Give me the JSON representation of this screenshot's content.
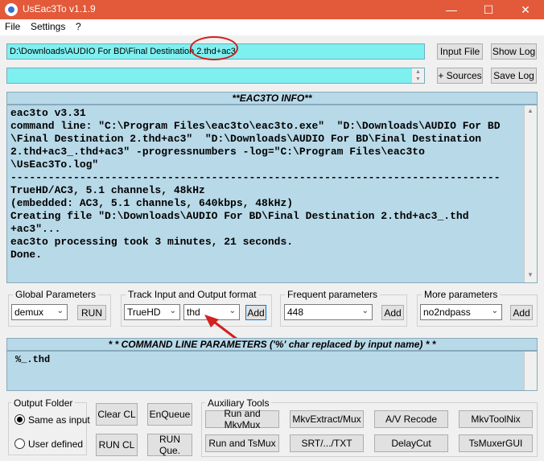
{
  "window": {
    "title": "UsEac3To v1.1.9",
    "minimize_glyph": "—",
    "maximize_glyph": "☐",
    "close_glyph": "✕"
  },
  "menu": {
    "file": "File",
    "settings": "Settings",
    "help": "?"
  },
  "input_path": "D:\\Downloads\\AUDIO For BD\\Final Destination 2.thd+ac3",
  "buttons": {
    "input_file": "Input File",
    "show_log": "Show Log",
    "add_sources": "+ Sources",
    "save_log": "Save Log",
    "run": "RUN",
    "add": "Add",
    "clear_cl": "Clear CL",
    "enqueue": "EnQueue",
    "run_cl": "RUN CL",
    "run_queue": "RUN Que."
  },
  "info_header": "**EAC3TO INFO**",
  "log_lines": [
    "eac3to v3.31",
    "command line: \"C:\\Program Files\\eac3to\\eac3to.exe\"  \"D:\\Downloads\\AUDIO For BD",
    "\\Final Destination 2.thd+ac3\"  \"D:\\Downloads\\AUDIO For BD\\Final Destination",
    "2.thd+ac3_.thd+ac3\" -progressnumbers -log=\"C:\\Program Files\\eac3to",
    "\\UsEac3To.log\"",
    "------------------------------------------------------------------------------",
    "TrueHD/AC3, 5.1 channels, 48kHz",
    "(embedded: AC3, 5.1 channels, 640kbps, 48kHz)",
    "Creating file \"D:\\Downloads\\AUDIO For BD\\Final Destination 2.thd+ac3_.thd",
    "+ac3\"...",
    "eac3to processing took 3 minutes, 21 seconds.",
    "Done."
  ],
  "global_params": {
    "label": "Global Parameters",
    "value": "demux"
  },
  "track_format": {
    "label": "Track Input and Output format",
    "input": "TrueHD",
    "output": "thd"
  },
  "frequent_params": {
    "label": "Frequent parameters",
    "value": "448"
  },
  "more_params": {
    "label": "More parameters",
    "value": "no2ndpass"
  },
  "cmdline_header": "* * COMMAND LINE PARAMETERS ('%' char replaced by input name) * *",
  "cmdline_value": "%_.thd",
  "output_folder": {
    "label": "Output Folder",
    "same": "Same as input",
    "user": "User defined",
    "selected": "same"
  },
  "aux": {
    "label": "Auxiliary Tools",
    "buttons": [
      "Run and MkvMux",
      "MkvExtract/Mux",
      "A/V Recode",
      "MkvToolNix",
      "Run and TsMux",
      "SRT/.../TXT",
      "DelayCut",
      "TsMuxerGUI"
    ]
  },
  "colors": {
    "titlebar": "#e25a3a",
    "input_bg": "#7ff0f0",
    "panel_bg": "#b8d9e8",
    "annotation": "#d32020"
  },
  "icons": [
    "app-icon",
    "chevron-down-icon",
    "scroll-up-icon",
    "scroll-down-icon",
    "annotation-arrow",
    "annotation-circle"
  ]
}
